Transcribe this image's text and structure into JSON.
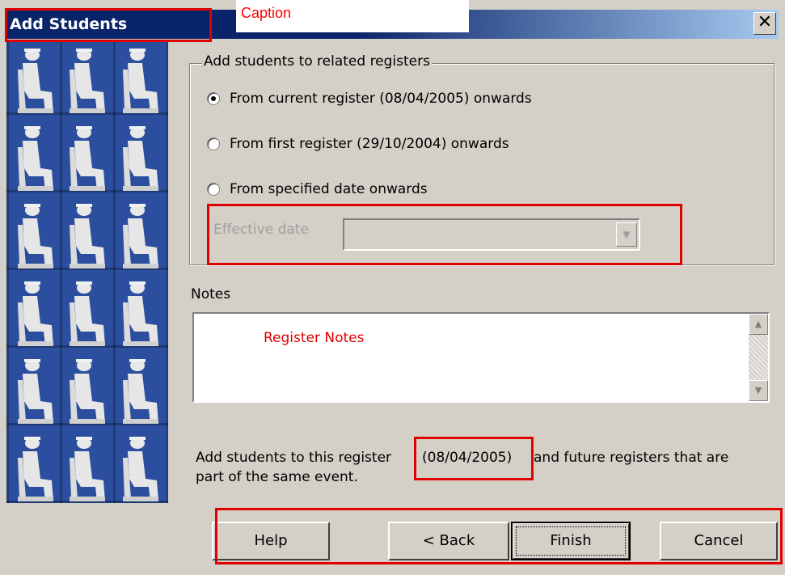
{
  "window": {
    "title": "Add Students",
    "caption_annotation": "Caption",
    "close_glyph": "✕"
  },
  "register_group": {
    "legend": "Add students to related registers",
    "options": [
      {
        "label": "From current register (08/04/2005) onwards",
        "checked": true
      },
      {
        "label": "From first register (29/10/2004) onwards",
        "checked": false
      },
      {
        "label": "From specified date onwards",
        "checked": false
      }
    ],
    "effective_date_label": "Effective date",
    "effective_date_value": ""
  },
  "notes": {
    "label": "Notes",
    "annotation": "Register Notes"
  },
  "info": {
    "line1_prefix": "Add students to this register",
    "date": "(08/04/2005)",
    "line1_suffix": "and future registers that are",
    "line2": "part of the same event."
  },
  "buttons": {
    "help": "Help",
    "back": "< Back",
    "finish": "Finish",
    "cancel": "Cancel"
  },
  "colors": {
    "annotation_red": "#e00000",
    "title_bar": "#0a246a",
    "dialog_bg": "#d4d0c8"
  }
}
